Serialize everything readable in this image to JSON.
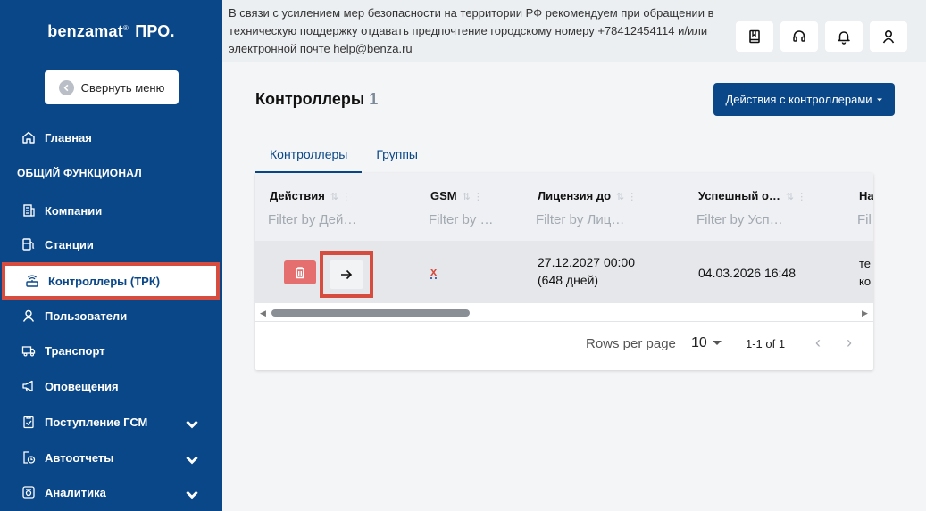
{
  "app": {
    "brand": "benzamat",
    "brand_reg": "®",
    "brand_suffix": "ПРО."
  },
  "sidebar": {
    "collapse_label": "Свернуть меню",
    "section_label": "ОБЩИЙ ФУНКЦИОНАЛ",
    "items": [
      {
        "label": "Главная",
        "icon": "home-icon"
      },
      {
        "label": "Компании",
        "icon": "building-icon"
      },
      {
        "label": "Станции",
        "icon": "fuel-station-icon"
      },
      {
        "label": "Контроллеры (ТРК)",
        "icon": "controller-icon",
        "active": true
      },
      {
        "label": "Пользователи",
        "icon": "user-icon"
      },
      {
        "label": "Транспорт",
        "icon": "truck-icon"
      },
      {
        "label": "Оповещения",
        "icon": "megaphone-icon"
      },
      {
        "label": "Поступление ГСМ",
        "icon": "clipboard-icon",
        "expandable": true
      },
      {
        "label": "Автоотчеты",
        "icon": "clock-report-icon",
        "expandable": true
      },
      {
        "label": "Аналитика",
        "icon": "analytics-icon",
        "expandable": true
      }
    ]
  },
  "banner": {
    "text": "В связи с усилением мер безопасности на территории РФ рекомендуем при обращении в техническую поддержку отдавать предпочтение городскому номеру +78412454114 и/или электронной почте help@benza.ru"
  },
  "page": {
    "title": "Контроллеры",
    "count": "1",
    "actions_label": "Действия с контроллерами",
    "tabs": [
      "Контроллеры",
      "Группы"
    ]
  },
  "table": {
    "columns": [
      {
        "header": "Действия",
        "filter": "Filter by Дей…"
      },
      {
        "header": "GSM",
        "filter": "Filter by …"
      },
      {
        "header": "Лицензия до",
        "filter": "Filter by Лиц…"
      },
      {
        "header": "Успешный о…",
        "filter": "Filter by Усп…"
      },
      {
        "header": "На",
        "filter": "Fil"
      }
    ],
    "rows": [
      {
        "gsm": "x",
        "license_date": "27.12.2027 00:00",
        "license_days": "(648 дней)",
        "success": "04.03.2026 16:48",
        "last_line1": "те",
        "last_line2": "ко"
      }
    ],
    "footer": {
      "rows_per_page_label": "Rows per page",
      "rows_per_page_value": "10",
      "range": "1-1 of 1"
    }
  },
  "colors": {
    "primary": "#0a4788",
    "highlight": "#d64c3f",
    "delete": "#e56e6e"
  }
}
